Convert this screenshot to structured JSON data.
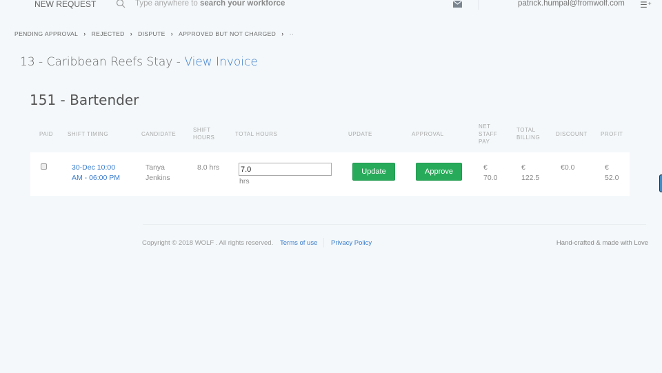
{
  "header": {
    "new_request": "NEW REQUEST",
    "search_placeholder_prefix": "Type anywhere to ",
    "search_placeholder_bold": "search your workforce",
    "user_email": "patrick.humpal@fromwolf.com"
  },
  "breadcrumb": [
    "PENDING APPROVAL",
    "REJECTED",
    "DISPUTE",
    "APPROVED BUT NOT CHARGED",
    "··"
  ],
  "event": {
    "title": "13 - Caribbean Reefs Stay - ",
    "link": "View Invoice"
  },
  "position": {
    "title": "151 - Bartender"
  },
  "table": {
    "headers": {
      "paid": "PAID",
      "timing": "SHIFT TIMING",
      "candidate": "CANDIDATE",
      "shift_hours": "SHIFT HOURS",
      "total_hours": "TOTAL HOURS",
      "update": "UPDATE",
      "approval": "APPROVAL",
      "net_pay": "NET STAFF PAY",
      "billing": "TOTAL BILLING",
      "discount": "DISCOUNT",
      "profit": "PROFIT"
    },
    "row": {
      "paid": false,
      "timing": "30-Dec 10:00 AM - 06:00 PM",
      "candidate": "Tanya Jenkins",
      "shift_hours": "8.0 hrs",
      "total_hours": "7.0",
      "hrs_unit": "hrs",
      "update_label": "Update",
      "approve_label": "Approve",
      "net_pay": "€ 70.0",
      "billing": "€ 122.5",
      "discount": "€0.0",
      "profit": "€ 52.0"
    }
  },
  "footer": {
    "copyright": "Copyright © 2018 WOLF . All rights reserved.",
    "terms": "Terms of use",
    "privacy": "Privacy Policy",
    "crafted": "Hand-crafted & made with Love"
  },
  "colors": {
    "accent": "#3a7ccc",
    "button": "#27ab5a",
    "background": "#f4f8fa"
  }
}
